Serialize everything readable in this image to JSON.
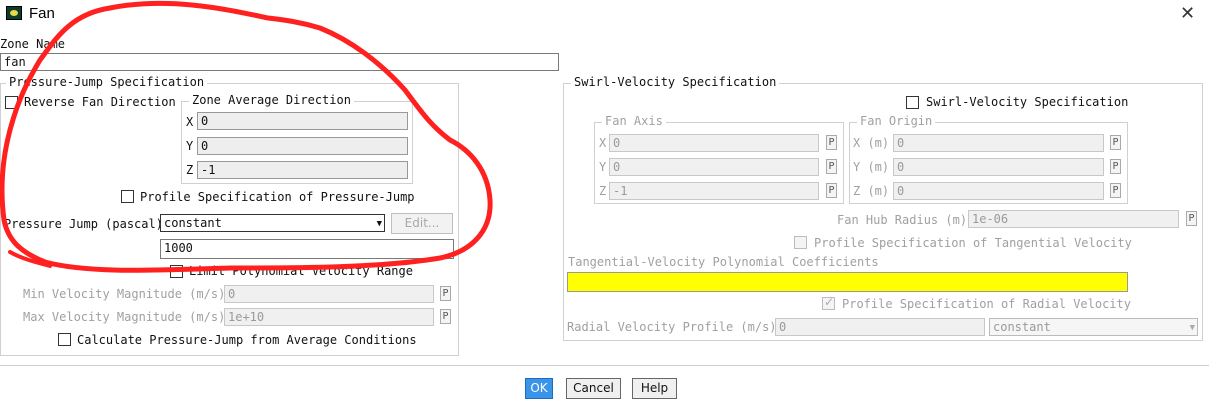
{
  "window": {
    "title": "Fan",
    "close_glyph": "✕"
  },
  "zone": {
    "label": "Zone Name",
    "value": "fan"
  },
  "pressure_jump": {
    "section_title": "Pressure-Jump Specification",
    "reverse_fan_label": "Reverse Fan Direction",
    "zone_avg_dir": {
      "title": "Zone Average Direction",
      "x_label": "X",
      "x_value": "0",
      "y_label": "Y",
      "y_value": "0",
      "z_label": "Z",
      "z_value": "-1"
    },
    "profile_spec_label": "Profile Specification of Pressure-Jump",
    "pressure_jump_label": "Pressure Jump (pascal)",
    "method_value": "constant",
    "edit_button": "Edit...",
    "value": "1000",
    "limit_poly_label": "Limit Polynomial Velocity Range",
    "min_vel_label": "Min Velocity Magnitude (m/s)",
    "min_vel_value": "0",
    "max_vel_label": "Max Velocity Magnitude (m/s)",
    "max_vel_value": "1e+10",
    "calc_avg_label": "Calculate Pressure-Jump from Average Conditions",
    "p_label": "P"
  },
  "swirl": {
    "section_title": "Swirl-Velocity Specification",
    "swirl_checkbox_label": "Swirl-Velocity Specification",
    "fan_axis": {
      "title": "Fan Axis",
      "x_label": "X",
      "x_value": "0",
      "y_label": "Y",
      "y_value": "0",
      "z_label": "Z",
      "z_value": "-1"
    },
    "fan_origin": {
      "title": "Fan Origin",
      "x_label": "X (m)",
      "x_value": "0",
      "y_label": "Y (m)",
      "y_value": "0",
      "z_label": "Z (m)",
      "z_value": "0"
    },
    "hub_radius_label": "Fan Hub Radius (m)",
    "hub_radius_value": "1e-06",
    "tangential_profile_label": "Profile Specification of Tangential Velocity",
    "tangential_poly_label": "Tangential-Velocity Polynomial Coefficients",
    "radial_profile_label": "Profile Specification of Radial Velocity",
    "radial_vel_label": "Radial Velocity Profile (m/s)",
    "radial_vel_value": "0",
    "radial_method_value": "constant",
    "p_label": "P"
  },
  "buttons": {
    "ok": "OK",
    "cancel": "Cancel",
    "help": "Help"
  },
  "annotation": {
    "color": "#ff2020"
  },
  "colors": {
    "highlight": "#ffff00",
    "primary_button": "#3a94e8"
  }
}
